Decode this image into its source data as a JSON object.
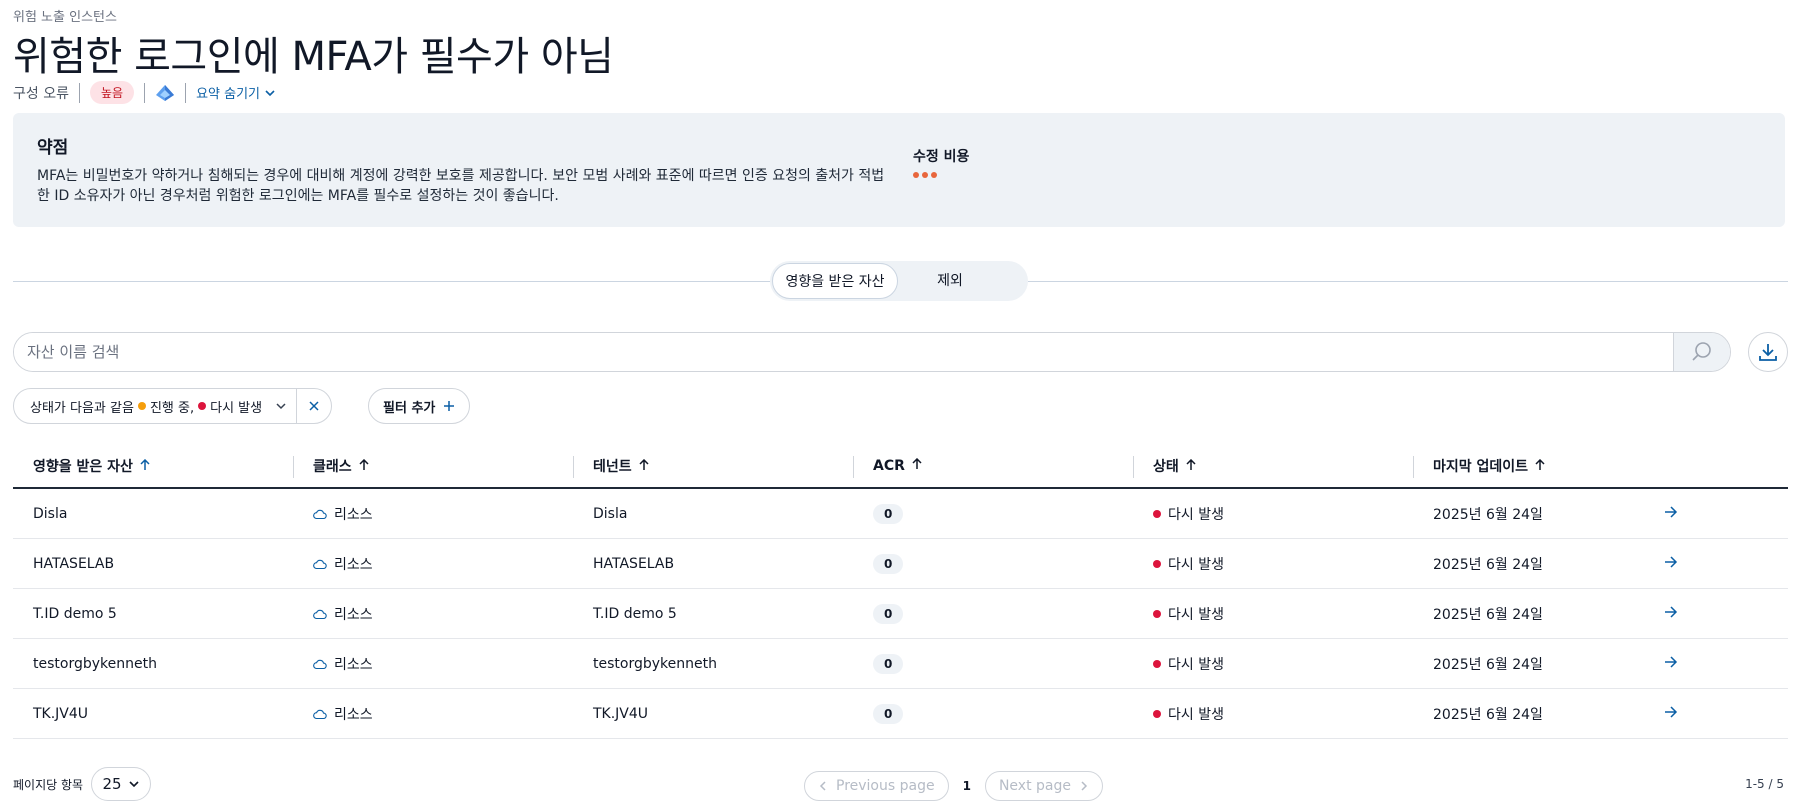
{
  "header": {
    "eyebrow": "위험 노출 인스턴스",
    "title": "위험한 로그인에 MFA가 필수가 아님",
    "category": "구성 오류",
    "severity": "높음",
    "severity_color": "#c1121f",
    "summary_toggle": "요약 숨기기"
  },
  "weakness": {
    "title": "약점",
    "text": "MFA는 비밀번호가 약하거나 침해되는 경우에 대비해 계정에 강력한 보호를 제공합니다. 보안 모범 사례와 표준에 따르면 인증 요청의 출처가 적법한 ID 소유자가 아닌 경우처럼 위험한 로그인에는 MFA를 필수로 설정하는 것이 좋습니다.",
    "fix_cost_label": "수정 비용",
    "fix_cost_color": "#e8663c"
  },
  "tabs": [
    {
      "label": "영향을 받은 자산",
      "active": true
    },
    {
      "label": "제외",
      "active": false
    }
  ],
  "search": {
    "placeholder": "자산 이름 검색"
  },
  "filter": {
    "prefix": "상태가 다음과 같음",
    "value1": "진행 중,",
    "value1_color": "#f59e0b",
    "value2": "다시 발생",
    "value2_color": "#dc143c",
    "add_label": "필터 추가"
  },
  "table": {
    "columns": [
      "영향을 받은 자산",
      "클래스",
      "테넌트",
      "ACR",
      "상태",
      "마지막 업데이트"
    ],
    "rows": [
      {
        "asset": "Disla",
        "class": "리소스",
        "tenant": "Disla",
        "acr": "0",
        "status": "다시 발생",
        "updated": "2025년 6월 24일"
      },
      {
        "asset": "HATASELAB",
        "class": "리소스",
        "tenant": "HATASELAB",
        "acr": "0",
        "status": "다시 발생",
        "updated": "2025년 6월 24일"
      },
      {
        "asset": "T.ID demo 5",
        "class": "리소스",
        "tenant": "T.ID demo 5",
        "acr": "0",
        "status": "다시 발생",
        "updated": "2025년 6월 24일"
      },
      {
        "asset": "testorgbykenneth",
        "class": "리소스",
        "tenant": "testorgbykenneth",
        "acr": "0",
        "status": "다시 발생",
        "updated": "2025년 6월 24일"
      },
      {
        "asset": "TK.JV4U",
        "class": "리소스",
        "tenant": "TK.JV4U",
        "acr": "0",
        "status": "다시 발생",
        "updated": "2025년 6월 24일"
      }
    ]
  },
  "pagination": {
    "per_page_label": "페이지당 항목",
    "per_page_value": "25",
    "prev_label": "Previous page",
    "next_label": "Next page",
    "current_page": "1",
    "range": "1-5 / 5"
  },
  "colors": {
    "accent": "#0b5fa5",
    "status_recurring": "#dc143c",
    "panel_bg": "#eef2f6"
  }
}
